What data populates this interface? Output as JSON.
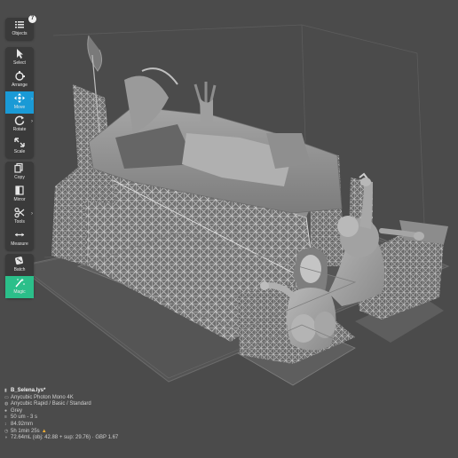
{
  "toolbar": {
    "objects": {
      "label": "Objects",
      "count": "7",
      "icon": "list-icon"
    },
    "select": {
      "label": "Select",
      "icon": "cursor-icon"
    },
    "arrange": {
      "label": "Arrange",
      "icon": "arrange-icon"
    },
    "move": {
      "label": "Move",
      "icon": "move-icon",
      "active": true
    },
    "rotate": {
      "label": "Rotate",
      "icon": "rotate-icon"
    },
    "scale": {
      "label": "Scale",
      "icon": "scale-icon"
    },
    "copy": {
      "label": "Copy",
      "icon": "copy-icon"
    },
    "mirror": {
      "label": "Mirror",
      "icon": "mirror-icon"
    },
    "tools": {
      "label": "Tools",
      "icon": "scissors-icon"
    },
    "measure": {
      "label": "Measure",
      "icon": "measure-icon"
    },
    "batch": {
      "label": "Batch",
      "icon": "dice-icon"
    },
    "magic": {
      "label": "Magic",
      "icon": "wand-icon"
    }
  },
  "info": {
    "filename": "B_Selena.lys*",
    "printer": "Anycubic Photon Mono 4K",
    "profile": "Anycubic Rapid / Basic / Standard",
    "color": "Grey",
    "layer": "50 um - 3 s",
    "height": "84.92mm",
    "time": "5h 1min 25s",
    "volume": "72.64mL (obj: 42.88 + sup: 29.76) · GBP 1.67"
  },
  "colors": {
    "accent_move": "#1a9ad6",
    "accent_magic": "#2bbf8a",
    "warning": "#f1b033",
    "background": "#4a4a4a"
  }
}
